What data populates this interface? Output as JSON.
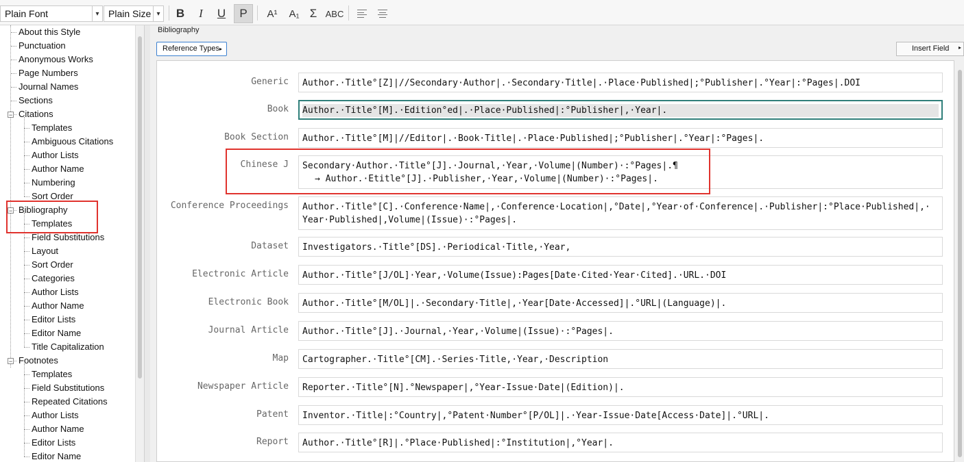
{
  "toolbar": {
    "font_value": "Plain Font",
    "size_value": "Plain Size",
    "bold": "B",
    "italic": "I",
    "underline": "U",
    "plain": "P",
    "superscript": "A¹",
    "subscript": "A₁",
    "sigma": "Σ",
    "smallcaps": "ABC"
  },
  "tree": {
    "items": [
      {
        "label": "About this Style",
        "level": 1
      },
      {
        "label": "Punctuation",
        "level": 1
      },
      {
        "label": "Anonymous Works",
        "level": 1
      },
      {
        "label": "Page Numbers",
        "level": 1
      },
      {
        "label": "Journal Names",
        "level": 1
      },
      {
        "label": "Sections",
        "level": 1
      },
      {
        "label": "Citations",
        "level": 0,
        "toggle": "−"
      },
      {
        "label": "Templates",
        "level": 2
      },
      {
        "label": "Ambiguous Citations",
        "level": 2
      },
      {
        "label": "Author Lists",
        "level": 2
      },
      {
        "label": "Author Name",
        "level": 2
      },
      {
        "label": "Numbering",
        "level": 2
      },
      {
        "label": "Sort Order",
        "level": 2
      },
      {
        "label": "Bibliography",
        "level": 0,
        "toggle": "−"
      },
      {
        "label": "Templates",
        "level": 2
      },
      {
        "label": "Field Substitutions",
        "level": 2
      },
      {
        "label": "Layout",
        "level": 2
      },
      {
        "label": "Sort Order",
        "level": 2
      },
      {
        "label": "Categories",
        "level": 2
      },
      {
        "label": "Author Lists",
        "level": 2
      },
      {
        "label": "Author Name",
        "level": 2
      },
      {
        "label": "Editor Lists",
        "level": 2
      },
      {
        "label": "Editor Name",
        "level": 2
      },
      {
        "label": "Title Capitalization",
        "level": 2
      },
      {
        "label": "Footnotes",
        "level": 0,
        "toggle": "−"
      },
      {
        "label": "Templates",
        "level": 2
      },
      {
        "label": "Field Substitutions",
        "level": 2
      },
      {
        "label": "Repeated Citations",
        "level": 2
      },
      {
        "label": "Author Lists",
        "level": 2
      },
      {
        "label": "Author Name",
        "level": 2
      },
      {
        "label": "Editor Lists",
        "level": 2
      },
      {
        "label": "Editor Name",
        "level": 2
      }
    ]
  },
  "panel": {
    "title": "Bibliography",
    "reference_types_label": "Reference Types",
    "insert_field_label": "Insert Field"
  },
  "templates": [
    {
      "label": "Generic",
      "lines": [
        "Author.·Title°[Z]|//Secondary·Author|.·Secondary·Title|.·Place·Published|;°Publisher|.°Year|:°Pages|.DOI"
      ]
    },
    {
      "label": "Book",
      "lines": [
        "Author.·Title°[M].·Edition°ed|.·Place·Published|:°Publisher|,·Year|."
      ]
    },
    {
      "label": "Book Section",
      "lines": [
        "Author.·Title°[M]|//Editor|.·Book·Title|.·Place·Published|;°Publisher|.°Year|:°Pages|."
      ]
    },
    {
      "label": "Chinese J",
      "lines": [
        "Secondary·Author.·Title°[J].·Journal,·Year,·Volume|(Number)·:°Pages|.¶",
        "→   Author.·Etitle°[J].·Publisher,·Year,·Volume|(Number)·:°Pages|."
      ]
    },
    {
      "label": "Conference Proceedings",
      "lines": [
        "Author.·Title°[C].·Conference·Name|,·Conference·Location|,°Date|,°Year·of·Conference|.·Publisher|:°Place·Published|,·",
        "Year·Published|,Volume|(Issue)·:°Pages|."
      ]
    },
    {
      "label": "Dataset",
      "lines": [
        "Investigators.·Title°[DS].·Periodical·Title,·Year,"
      ]
    },
    {
      "label": "Electronic Article",
      "lines": [
        "Author.·Title°[J/OL]·Year,·Volume(Issue):Pages[Date·Cited·Year·Cited].·URL.·DOI"
      ]
    },
    {
      "label": "Electronic Book",
      "lines": [
        "Author.·Title°[M/OL]|.·Secondary·Title|,·Year[Date·Accessed]|.°URL|(Language)|."
      ]
    },
    {
      "label": "Journal Article",
      "lines": [
        "Author.·Title°[J].·Journal,·Year,·Volume|(Issue)·:°Pages|."
      ]
    },
    {
      "label": "Map",
      "lines": [
        "Cartographer.·Title°[CM].·Series·Title,·Year,·Description"
      ]
    },
    {
      "label": "Newspaper Article",
      "lines": [
        "Reporter.·Title°[N].°Newspaper|,°Year-Issue·Date|(Edition)|."
      ]
    },
    {
      "label": "Patent",
      "lines": [
        "Inventor.·Title|:°Country|,°Patent·Number°[P/OL]|.·Year-Issue·Date[Access·Date]|.°URL|."
      ]
    },
    {
      "label": "Report",
      "lines": [
        "Author.·Title°[R]|.°Place·Published|:°Institution|,°Year|."
      ]
    }
  ],
  "colors": {
    "highlight_box": "#e0322d",
    "focus_border": "#2f7f7a",
    "ref_button_border": "#3a7fd0"
  }
}
